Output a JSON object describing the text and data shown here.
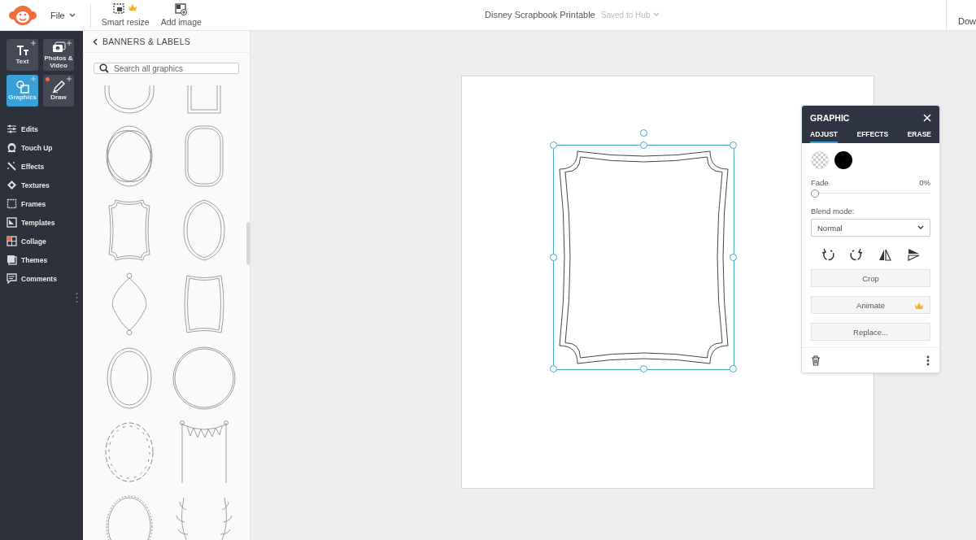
{
  "topbar": {
    "file_menu": "File",
    "actions": [
      {
        "label": "Smart resize",
        "premium": true
      },
      {
        "label": "Add image",
        "premium": false
      }
    ],
    "document_title": "Disney Scrapbook Printable",
    "save_status": "Saved to Hub",
    "right_button": "Dow"
  },
  "tool_tiles": [
    {
      "label": "Text",
      "selected": false,
      "badge": false
    },
    {
      "label": "Photos & Video",
      "selected": false,
      "badge": false
    },
    {
      "label": "Graphics",
      "selected": true,
      "badge": false
    },
    {
      "label": "Draw",
      "selected": false,
      "badge": true
    }
  ],
  "rail_items": [
    {
      "label": "Edits"
    },
    {
      "label": "Touch Up"
    },
    {
      "label": "Effects"
    },
    {
      "label": "Textures"
    },
    {
      "label": "Frames"
    },
    {
      "label": "Templates"
    },
    {
      "label": "Collage"
    },
    {
      "label": "Themes"
    },
    {
      "label": "Comments"
    }
  ],
  "graphics_panel": {
    "title": "BANNERS & LABELS",
    "search": {
      "placeholder": "Search all graphics"
    }
  },
  "graphic_panel": {
    "title": "GRAPHIC",
    "tabs": [
      {
        "label": "ADJUST",
        "selected": true
      },
      {
        "label": "EFFECTS",
        "selected": false
      },
      {
        "label": "ERASE",
        "selected": false
      }
    ],
    "colors": [
      {
        "kind": "transparent",
        "selected": false
      },
      {
        "kind": "solid",
        "color": "#000000",
        "selected": false
      }
    ],
    "fade": {
      "label": "Fade",
      "reading": "0%",
      "level": 0
    },
    "blend_mode": {
      "label": "Blend mode:",
      "value": "Normal"
    },
    "buttons": [
      {
        "label": "Crop",
        "premium": false
      },
      {
        "label": "Animate",
        "premium": true
      },
      {
        "label": "Replace...",
        "premium": false
      }
    ]
  }
}
